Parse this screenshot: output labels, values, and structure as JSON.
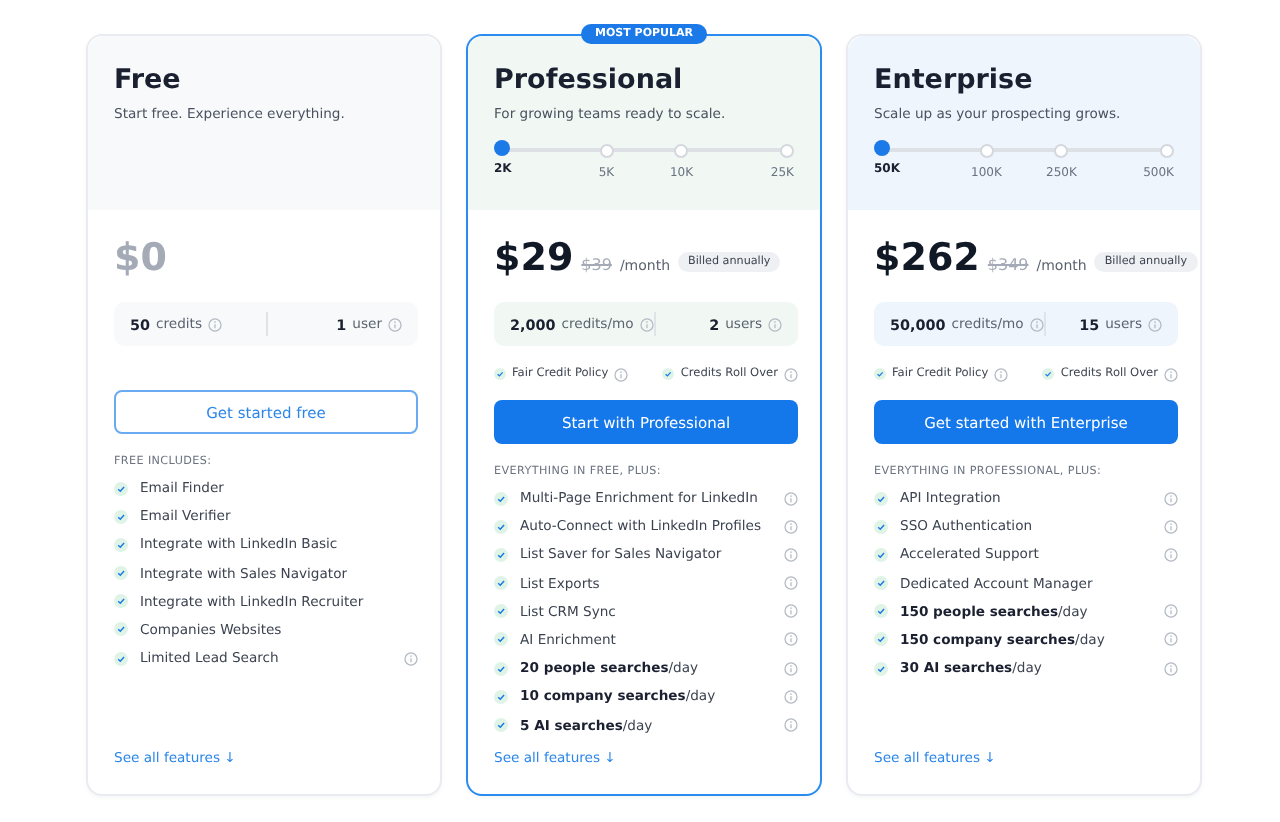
{
  "plans": [
    {
      "name": "Free",
      "tagline": "Start free. Experience everything.",
      "featured": false,
      "price": "$0",
      "price_muted": true,
      "credits_value": "50",
      "credits_label": "credits",
      "users_value": "1",
      "users_label": "user",
      "cta": {
        "label": "Get started free",
        "kind": "outline"
      },
      "features_heading": "FREE INCLUDES:",
      "features": [
        {
          "text": "Email Finder",
          "info": false
        },
        {
          "text": "Email Verifier",
          "info": false
        },
        {
          "text": "Integrate with LinkedIn Basic",
          "info": false
        },
        {
          "text": "Integrate with Sales Navigator",
          "info": false
        },
        {
          "text": "Integrate with LinkedIn Recruiter",
          "info": false
        },
        {
          "text": "Companies Websites",
          "info": false
        },
        {
          "text": "Limited Lead Search",
          "info": true
        }
      ],
      "see_all": "See all features ↓"
    },
    {
      "name": "Professional",
      "badge": "MOST POPULAR",
      "tagline": "For growing teams ready to scale.",
      "featured": true,
      "slider": {
        "ticks": [
          {
            "label": "2K",
            "selected": true
          },
          {
            "label": "5K",
            "selected": false
          },
          {
            "label": "10K",
            "selected": false
          },
          {
            "label": "25K",
            "selected": false
          }
        ]
      },
      "price": "$29",
      "price_muted": false,
      "old_price": "$39",
      "period": "/month",
      "billing": "Billed annually",
      "credits_value": "2,000",
      "credits_label": "credits/mo",
      "users_value": "2",
      "users_label": "users",
      "policies": [
        "Fair Credit Policy",
        "Credits Roll Over"
      ],
      "cta": {
        "label": "Start with Professional",
        "kind": "filled"
      },
      "features_heading": "EVERYTHING IN FREE, PLUS:",
      "features": [
        {
          "text": "Multi-Page Enrichment for LinkedIn",
          "info": true
        },
        {
          "text": "Auto-Connect with LinkedIn Profiles",
          "info": true
        },
        {
          "text": "List Saver for Sales Navigator",
          "info": true
        },
        {
          "text": "List Exports",
          "info": true
        },
        {
          "text": "List CRM Sync",
          "info": true
        },
        {
          "text": "AI Enrichment",
          "info": true
        },
        {
          "text": "**20 people searches**/day",
          "info": true
        },
        {
          "text": "**10 company searches**/day",
          "info": true
        },
        {
          "text": "**5 AI searches**/day",
          "info": true
        }
      ],
      "see_all": "See all features ↓"
    },
    {
      "name": "Enterprise",
      "tagline": "Scale up as your prospecting grows.",
      "featured": false,
      "slider": {
        "ticks": [
          {
            "label": "50K",
            "selected": true
          },
          {
            "label": "100K",
            "selected": false
          },
          {
            "label": "250K",
            "selected": false
          },
          {
            "label": "500K",
            "selected": false
          }
        ]
      },
      "price": "$262",
      "price_muted": false,
      "old_price": "$349",
      "period": "/month",
      "billing": "Billed annually",
      "credits_value": "50,000",
      "credits_label": "credits/mo",
      "users_value": "15",
      "users_label": "users",
      "policies": [
        "Fair Credit Policy",
        "Credits Roll Over"
      ],
      "cta": {
        "label": "Get started with Enterprise",
        "kind": "filled"
      },
      "features_heading": "EVERYTHING IN PROFESSIONAL, PLUS:",
      "features": [
        {
          "text": "API Integration",
          "info": true
        },
        {
          "text": "SSO Authentication",
          "info": true
        },
        {
          "text": "Accelerated Support",
          "info": true
        },
        {
          "text": "Dedicated Account Manager",
          "info": false
        },
        {
          "text": "**150 people searches**/day",
          "info": true
        },
        {
          "text": "**150 company searches**/day",
          "info": true
        },
        {
          "text": "**30 AI searches**/day",
          "info": true
        }
      ],
      "see_all": "See all features ↓"
    }
  ]
}
